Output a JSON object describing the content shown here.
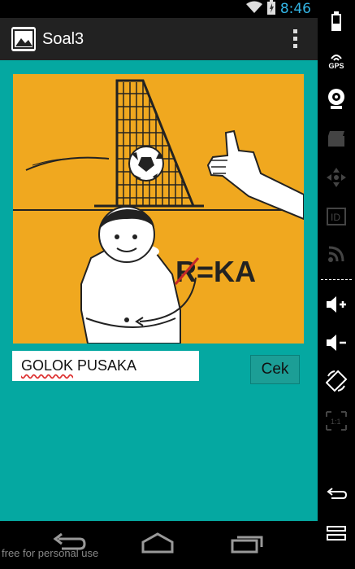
{
  "status_bar": {
    "time": "8:46"
  },
  "action_bar": {
    "title": "Soal3"
  },
  "puzzle": {
    "rebus_text": "R=KA",
    "alt_label": "puzzle-image"
  },
  "answer": {
    "value_part1": "GOLOK",
    "value_part2": " PUSAKA"
  },
  "check_button": {
    "label": "Cek"
  },
  "watermark": "free for personal use",
  "side_panel": {
    "gps_label": "GPS",
    "id_label": "ID",
    "ratio_label": "1:1"
  },
  "colors": {
    "background": "#05a8a1",
    "puzzle_bg": "#f0a81f",
    "button": "#1c9e96",
    "accent": "#33b5e5"
  }
}
